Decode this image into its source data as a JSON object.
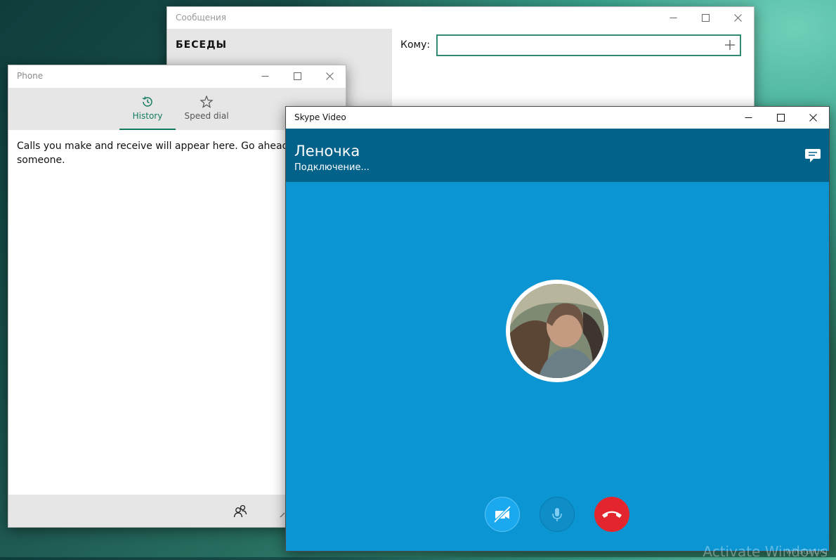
{
  "messages_window": {
    "title": "Сообщения",
    "sidebar_title": "БЕСЕДЫ",
    "to_label": "Кому:",
    "to_value": "",
    "to_placeholder": ""
  },
  "phone_window": {
    "title": "Phone",
    "tabs": [
      {
        "label": "History",
        "icon": "history-icon",
        "active": true
      },
      {
        "label": "Speed dial",
        "icon": "star-icon",
        "active": false
      }
    ],
    "empty_text": "Calls you make and receive will appear here. Go ahead and",
    "empty_text_2": "someone.",
    "accent": "#137a62"
  },
  "skype_window": {
    "title": "Skype Video",
    "contact_name": "Леночка",
    "status": "Подключение...",
    "colors": {
      "header": "#03628a",
      "body": "#0b95d3",
      "end_call": "#e3262d"
    },
    "buttons": [
      "camera-off-icon",
      "microphone-icon",
      "end-call-icon"
    ]
  },
  "desktop": {
    "watermark": "Activate Windows",
    "site": "winstart.ru"
  }
}
